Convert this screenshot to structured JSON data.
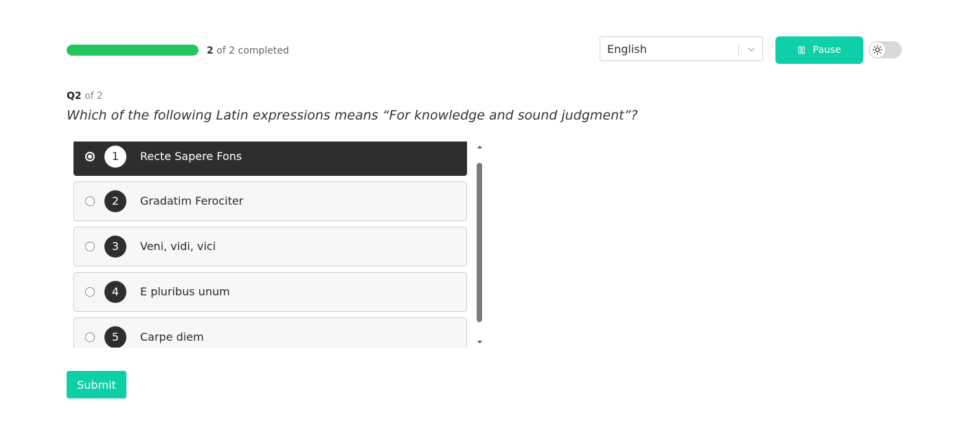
{
  "progress": {
    "fraction": 1.0,
    "completed": "2",
    "rest": "of 2 completed",
    "color": "#22c55e"
  },
  "language": {
    "selected": "English"
  },
  "pause_button": {
    "label": "Pause",
    "color": "#0fcfa8"
  },
  "theme_toggle": {
    "icon": "sun-icon",
    "state": "light"
  },
  "question": {
    "number": "Q2",
    "of_total": "of 2",
    "text": "Which of the following Latin expressions means “For knowledge and sound judgment”?"
  },
  "options": [
    {
      "number": "1",
      "label": "Recte Sapere Fons",
      "selected": true
    },
    {
      "number": "2",
      "label": "Gradatim Ferociter",
      "selected": false
    },
    {
      "number": "3",
      "label": "Veni, vidi, vici",
      "selected": false
    },
    {
      "number": "4",
      "label": "E pluribus unum",
      "selected": false
    },
    {
      "number": "5",
      "label": "Carpe diem",
      "selected": false
    }
  ],
  "submit": {
    "label": "Submit",
    "color": "#0fcfa8"
  }
}
